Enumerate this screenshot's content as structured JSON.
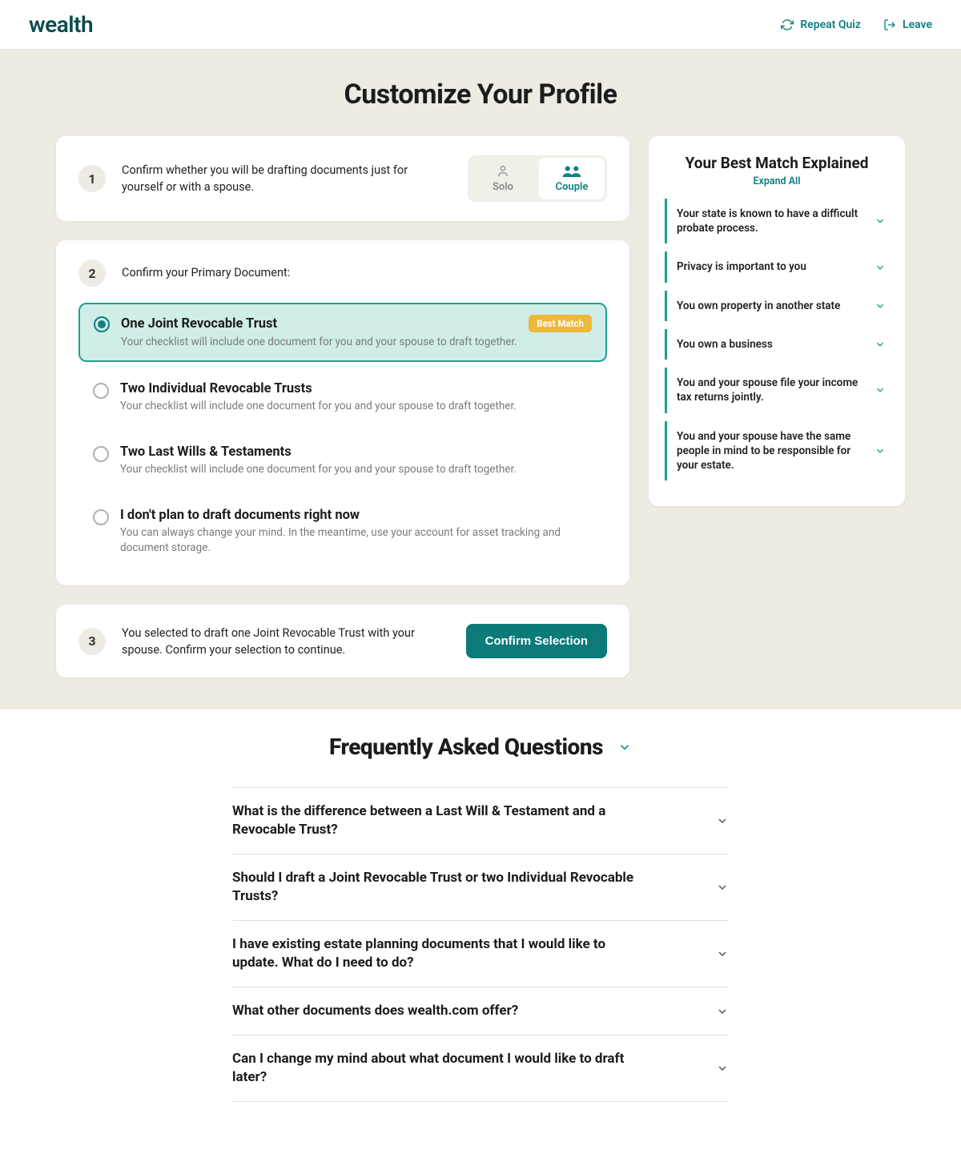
{
  "header": {
    "logo": "wealth",
    "repeat_quiz": "Repeat Quiz",
    "leave": "Leave"
  },
  "page_title": "Customize Your Profile",
  "step1": {
    "num": "1",
    "text": "Confirm whether you will be drafting documents just for yourself or with a spouse.",
    "solo_label": "Solo",
    "couple_label": "Couple"
  },
  "step2": {
    "num": "2",
    "text": "Confirm your Primary Document:",
    "best_match_label": "Best Match",
    "options": [
      {
        "title": "One Joint Revocable Trust",
        "desc": "Your checklist will include one document for you and your spouse to draft together.",
        "selected": true,
        "best_match": true
      },
      {
        "title": "Two Individual Revocable Trusts",
        "desc": "Your checklist will include one document for you and your spouse to draft together.",
        "selected": false,
        "best_match": false
      },
      {
        "title": "Two Last Wills & Testaments",
        "desc": "Your checklist will include one document for you and your spouse to draft together.",
        "selected": false,
        "best_match": false
      },
      {
        "title": "I don't plan to draft documents right now",
        "desc": "You can always change your mind. In the meantime, use your account for asset tracking and document storage.",
        "selected": false,
        "best_match": false
      }
    ]
  },
  "step3": {
    "num": "3",
    "text": "You selected to draft one Joint Revocable Trust with your spouse. Confirm your selection to continue.",
    "confirm_label": "Confirm Selection"
  },
  "sidebar": {
    "title": "Your Best Match Explained",
    "expand_all": "Expand All",
    "items": [
      "Your state is known to have a difficult probate process.",
      "Privacy is important to you",
      "You own property in another state",
      "You own a business",
      "You and your spouse file your income tax returns jointly.",
      "You and your spouse have the same people in mind to be responsible for your estate."
    ]
  },
  "faq": {
    "title": "Frequently Asked Questions",
    "items": [
      "What is the difference between a Last Will & Testament and a Revocable Trust?",
      "Should I draft a Joint Revocable Trust or two Individual Revocable Trusts?",
      "I have existing estate planning documents that I would like to update. What do I need to do?",
      "What other documents does wealth.com offer?",
      "Can I change my mind about what document I would like to draft later?"
    ]
  }
}
